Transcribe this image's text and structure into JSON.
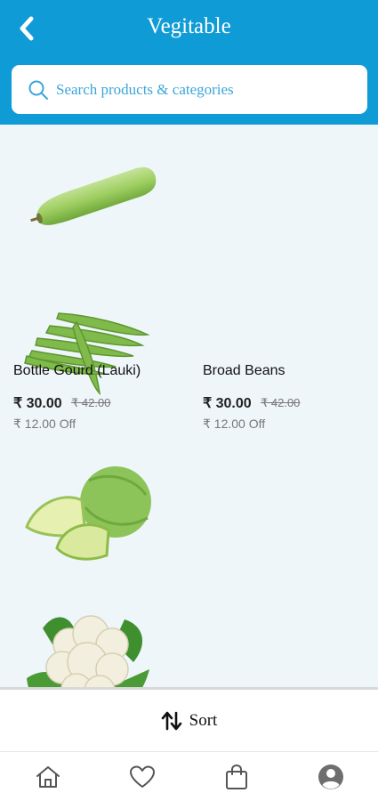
{
  "header": {
    "title": "Vegitable",
    "back_icon": "chevron-left-icon",
    "background_color": "#0f9bd6"
  },
  "search": {
    "placeholder": "Search products & categories",
    "icon": "search-icon"
  },
  "products": [
    {
      "name": "Bottle Gourd (Lauki)",
      "price": "₹ 30.00",
      "old_price": "₹ 42.00",
      "discount": "₹ 12.00 Off"
    },
    {
      "name": "Broad Beans",
      "price": "₹ 30.00",
      "old_price": "₹ 42.00",
      "discount": "₹ 12.00 Off"
    },
    {
      "name": "",
      "price": "",
      "old_price": "",
      "discount": ""
    },
    {
      "name": "",
      "price": "",
      "old_price": "",
      "discount": ""
    }
  ],
  "sort": {
    "label": "Sort",
    "icon": "sort-arrows-icon"
  },
  "tabbar": {
    "items": [
      {
        "icon": "home-icon"
      },
      {
        "icon": "heart-icon"
      },
      {
        "icon": "shopping-bag-icon"
      },
      {
        "icon": "profile-icon"
      }
    ]
  }
}
